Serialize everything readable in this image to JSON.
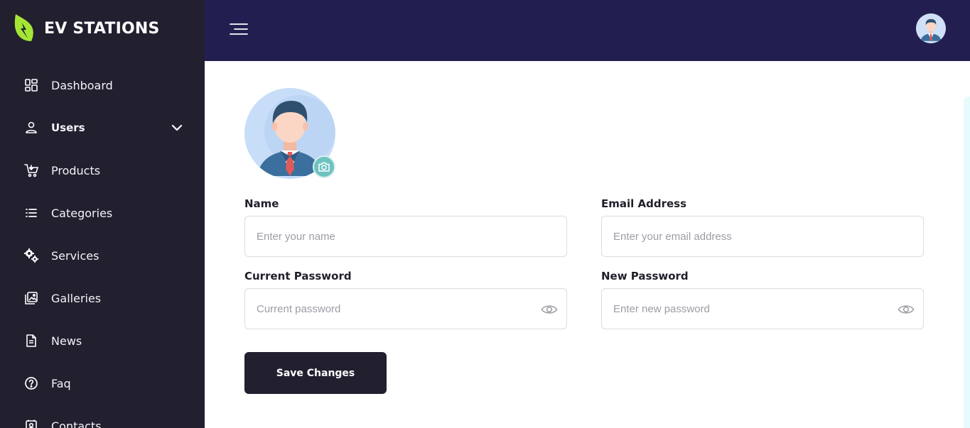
{
  "brand": {
    "name": "EV STATIONS",
    "logo_icon": "leaf-bolt-icon",
    "accent_color": "#a3e635"
  },
  "sidebar": {
    "items": [
      {
        "label": "Dashboard",
        "icon": "dashboard-icon"
      },
      {
        "label": "Users",
        "icon": "user-icon",
        "active": true,
        "expandable": true
      },
      {
        "label": "Products",
        "icon": "cart-icon"
      },
      {
        "label": "Categories",
        "icon": "list-icon"
      },
      {
        "label": "Services",
        "icon": "gears-icon"
      },
      {
        "label": "Galleries",
        "icon": "gallery-icon"
      },
      {
        "label": "News",
        "icon": "document-icon"
      },
      {
        "label": "Faq",
        "icon": "question-icon"
      },
      {
        "label": "Contacts",
        "icon": "contact-icon"
      }
    ]
  },
  "header": {
    "menu_icon": "hamburger-icon",
    "avatar_icon": "user-avatar-icon"
  },
  "form": {
    "name": {
      "label": "Name",
      "placeholder": "Enter your name"
    },
    "email": {
      "label": "Email Address",
      "placeholder": "Enter your email address"
    },
    "current_password": {
      "label": "Current Password",
      "placeholder": "Current password"
    },
    "new_password": {
      "label": "New Password",
      "placeholder": "Enter new password"
    },
    "save_label": "Save Changes"
  },
  "colors": {
    "sidebar_bg": "#221f2f",
    "header_bg": "#221f50",
    "camera_badge": "#6ec2c0",
    "button_bg": "#221f2f"
  }
}
